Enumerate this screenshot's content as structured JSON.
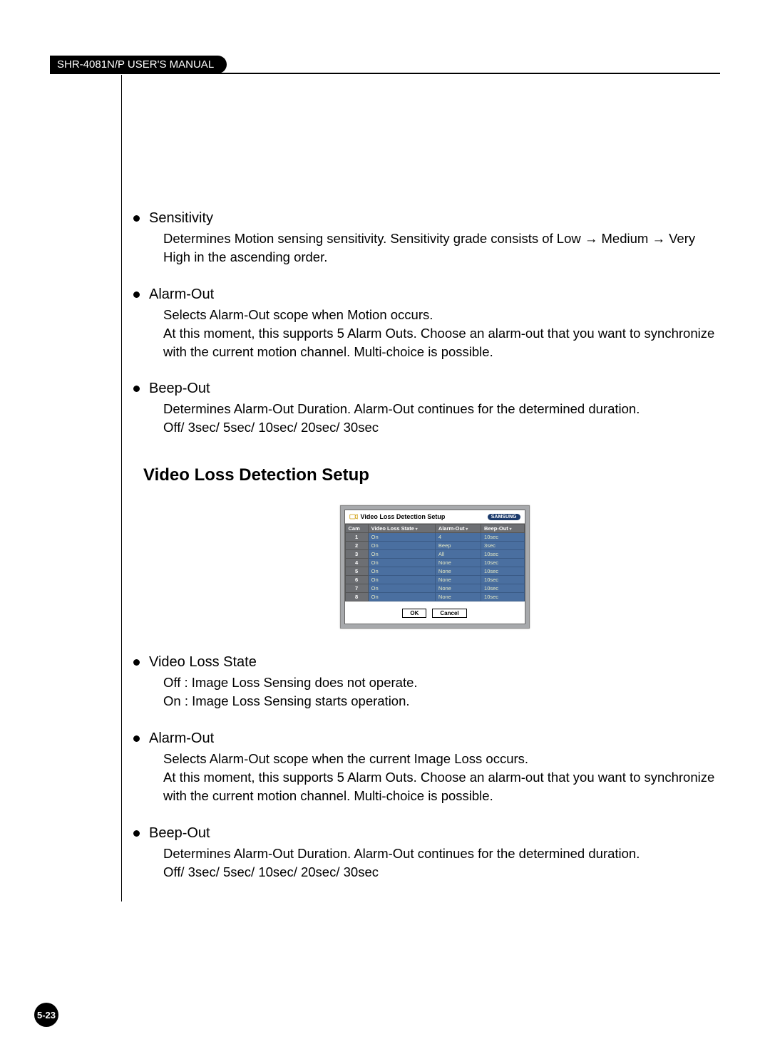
{
  "header": {
    "title": "SHR-4081N/P USER'S MANUAL"
  },
  "page_number": "5-23",
  "items_top": [
    {
      "title": "Sensitivity",
      "body": "Determines Motion sensing sensitivity. Sensitivity grade consists of Low → Medium → Very High in the ascending order."
    },
    {
      "title": "Alarm-Out",
      "body": "Selects Alarm-Out scope when Motion occurs.\nAt this moment, this supports 5 Alarm Outs. Choose an alarm-out that you want to synchronize with the current motion channel. Multi-choice is possible."
    },
    {
      "title": "Beep-Out",
      "body": "Determines Alarm-Out Duration. Alarm-Out continues for the determined duration.\nOff/ 3sec/ 5sec/ 10sec/ 20sec/ 30sec"
    }
  ],
  "section_heading": "Video Loss Detection Setup",
  "dialog": {
    "title": "Video Loss Detection Setup",
    "brand": "SAMSUNG",
    "headers": {
      "cam": "Cam",
      "state": "Video Loss State",
      "alarm": "Alarm-Out",
      "beep": "Beep-Out"
    },
    "rows": [
      {
        "cam": "1",
        "state": "On",
        "alarm": "4",
        "beep": "10sec"
      },
      {
        "cam": "2",
        "state": "On",
        "alarm": "Beep",
        "beep": "3sec"
      },
      {
        "cam": "3",
        "state": "On",
        "alarm": "All",
        "beep": "10sec"
      },
      {
        "cam": "4",
        "state": "On",
        "alarm": "None",
        "beep": "10sec"
      },
      {
        "cam": "5",
        "state": "On",
        "alarm": "None",
        "beep": "10sec"
      },
      {
        "cam": "6",
        "state": "On",
        "alarm": "None",
        "beep": "10sec"
      },
      {
        "cam": "7",
        "state": "On",
        "alarm": "None",
        "beep": "10sec"
      },
      {
        "cam": "8",
        "state": "On",
        "alarm": "None",
        "beep": "10sec"
      }
    ],
    "ok": "OK",
    "cancel": "Cancel"
  },
  "items_bottom": [
    {
      "title": "Video Loss State",
      "body": "Off : Image Loss Sensing does not operate.\nOn : Image Loss Sensing starts operation."
    },
    {
      "title": "Alarm-Out",
      "body": "Selects Alarm-Out scope when the current Image Loss occurs.\nAt this moment, this supports 5 Alarm Outs. Choose an alarm-out that you want to synchronize with the current motion channel. Multi-choice is possible."
    },
    {
      "title": "Beep-Out",
      "body": "Determines Alarm-Out Duration. Alarm-Out continues for the determined duration.\nOff/ 3sec/ 5sec/ 10sec/ 20sec/ 30sec"
    }
  ]
}
